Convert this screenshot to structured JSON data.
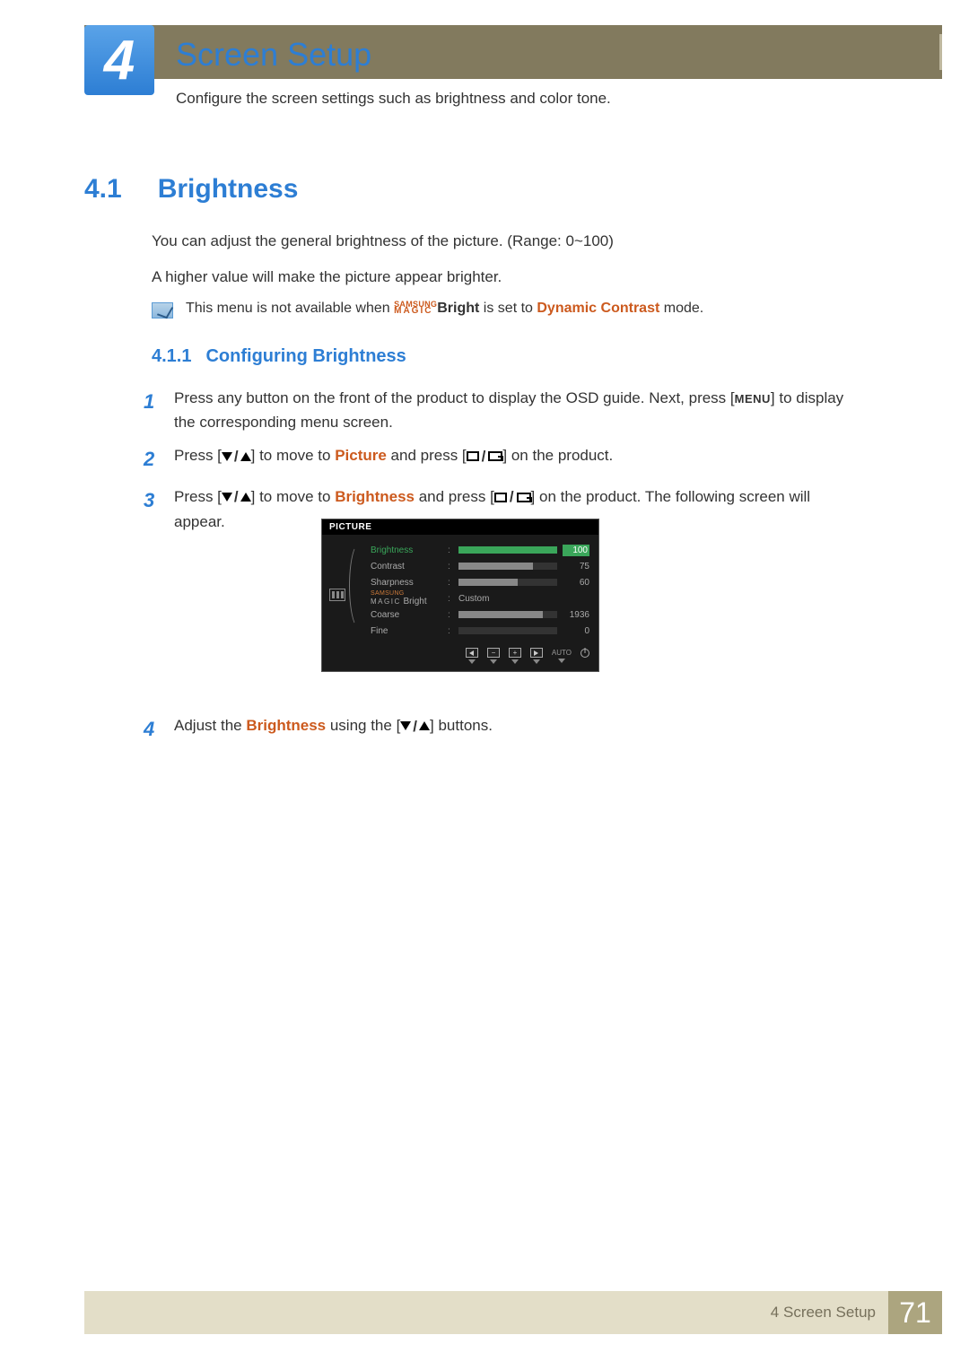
{
  "chapter": {
    "num": "4",
    "title": "Screen Setup",
    "intro": "Configure the screen settings such as brightness and color tone."
  },
  "section": {
    "num": "4.1",
    "title": "Brightness"
  },
  "body": {
    "p1": "You can adjust the general brightness of the picture. (Range: 0~100)",
    "p2": "A higher value will make the picture appear brighter.",
    "note_pre": "This menu is not available when ",
    "note_brand_top": "SAMSUNG",
    "note_brand_bot": "MAGIC",
    "note_bright": "Bright",
    "note_mid": " is set to ",
    "note_mode": "Dynamic Contrast",
    "note_post": " mode."
  },
  "subsection": {
    "num": "4.1.1",
    "title": "Configuring Brightness"
  },
  "steps": {
    "s1a": "Press any button on the front of the product to display the OSD guide. Next, press [",
    "s1_menu": "MENU",
    "s1b": "] to display the corresponding menu screen.",
    "s2a": "Press [",
    "s2b": "] to move to ",
    "s2_target": "Picture",
    "s2c": " and press [",
    "s2d": "] on the product.",
    "s3a": "Press [",
    "s3b": "] to move to ",
    "s3_target": "Brightness",
    "s3c": " and press [",
    "s3d": "] on the product. The following screen will appear.",
    "s4a": "Adjust the ",
    "s4_target": "Brightness",
    "s4b": " using the [",
    "s4c": "] buttons."
  },
  "osd": {
    "title": "PICTURE",
    "rows": [
      {
        "label": "Brightness",
        "value": "100",
        "pct": 100,
        "selected": true,
        "type": "bar"
      },
      {
        "label": "Contrast",
        "value": "75",
        "pct": 75,
        "selected": false,
        "type": "bar"
      },
      {
        "label": "Sharpness",
        "value": "60",
        "pct": 60,
        "selected": false,
        "type": "bar"
      },
      {
        "label_top": "SAMSUNG",
        "label_bot": "MAGIC",
        "label_suffix": " Bright",
        "value": "Custom",
        "type": "text"
      },
      {
        "label": "Coarse",
        "value": "1936",
        "pct": 85,
        "selected": false,
        "type": "bar"
      },
      {
        "label": "Fine",
        "value": "0",
        "pct": 0,
        "selected": false,
        "type": "bar"
      }
    ],
    "footer_auto": "AUTO"
  },
  "footer": {
    "label": "4 Screen Setup",
    "page": "71"
  }
}
